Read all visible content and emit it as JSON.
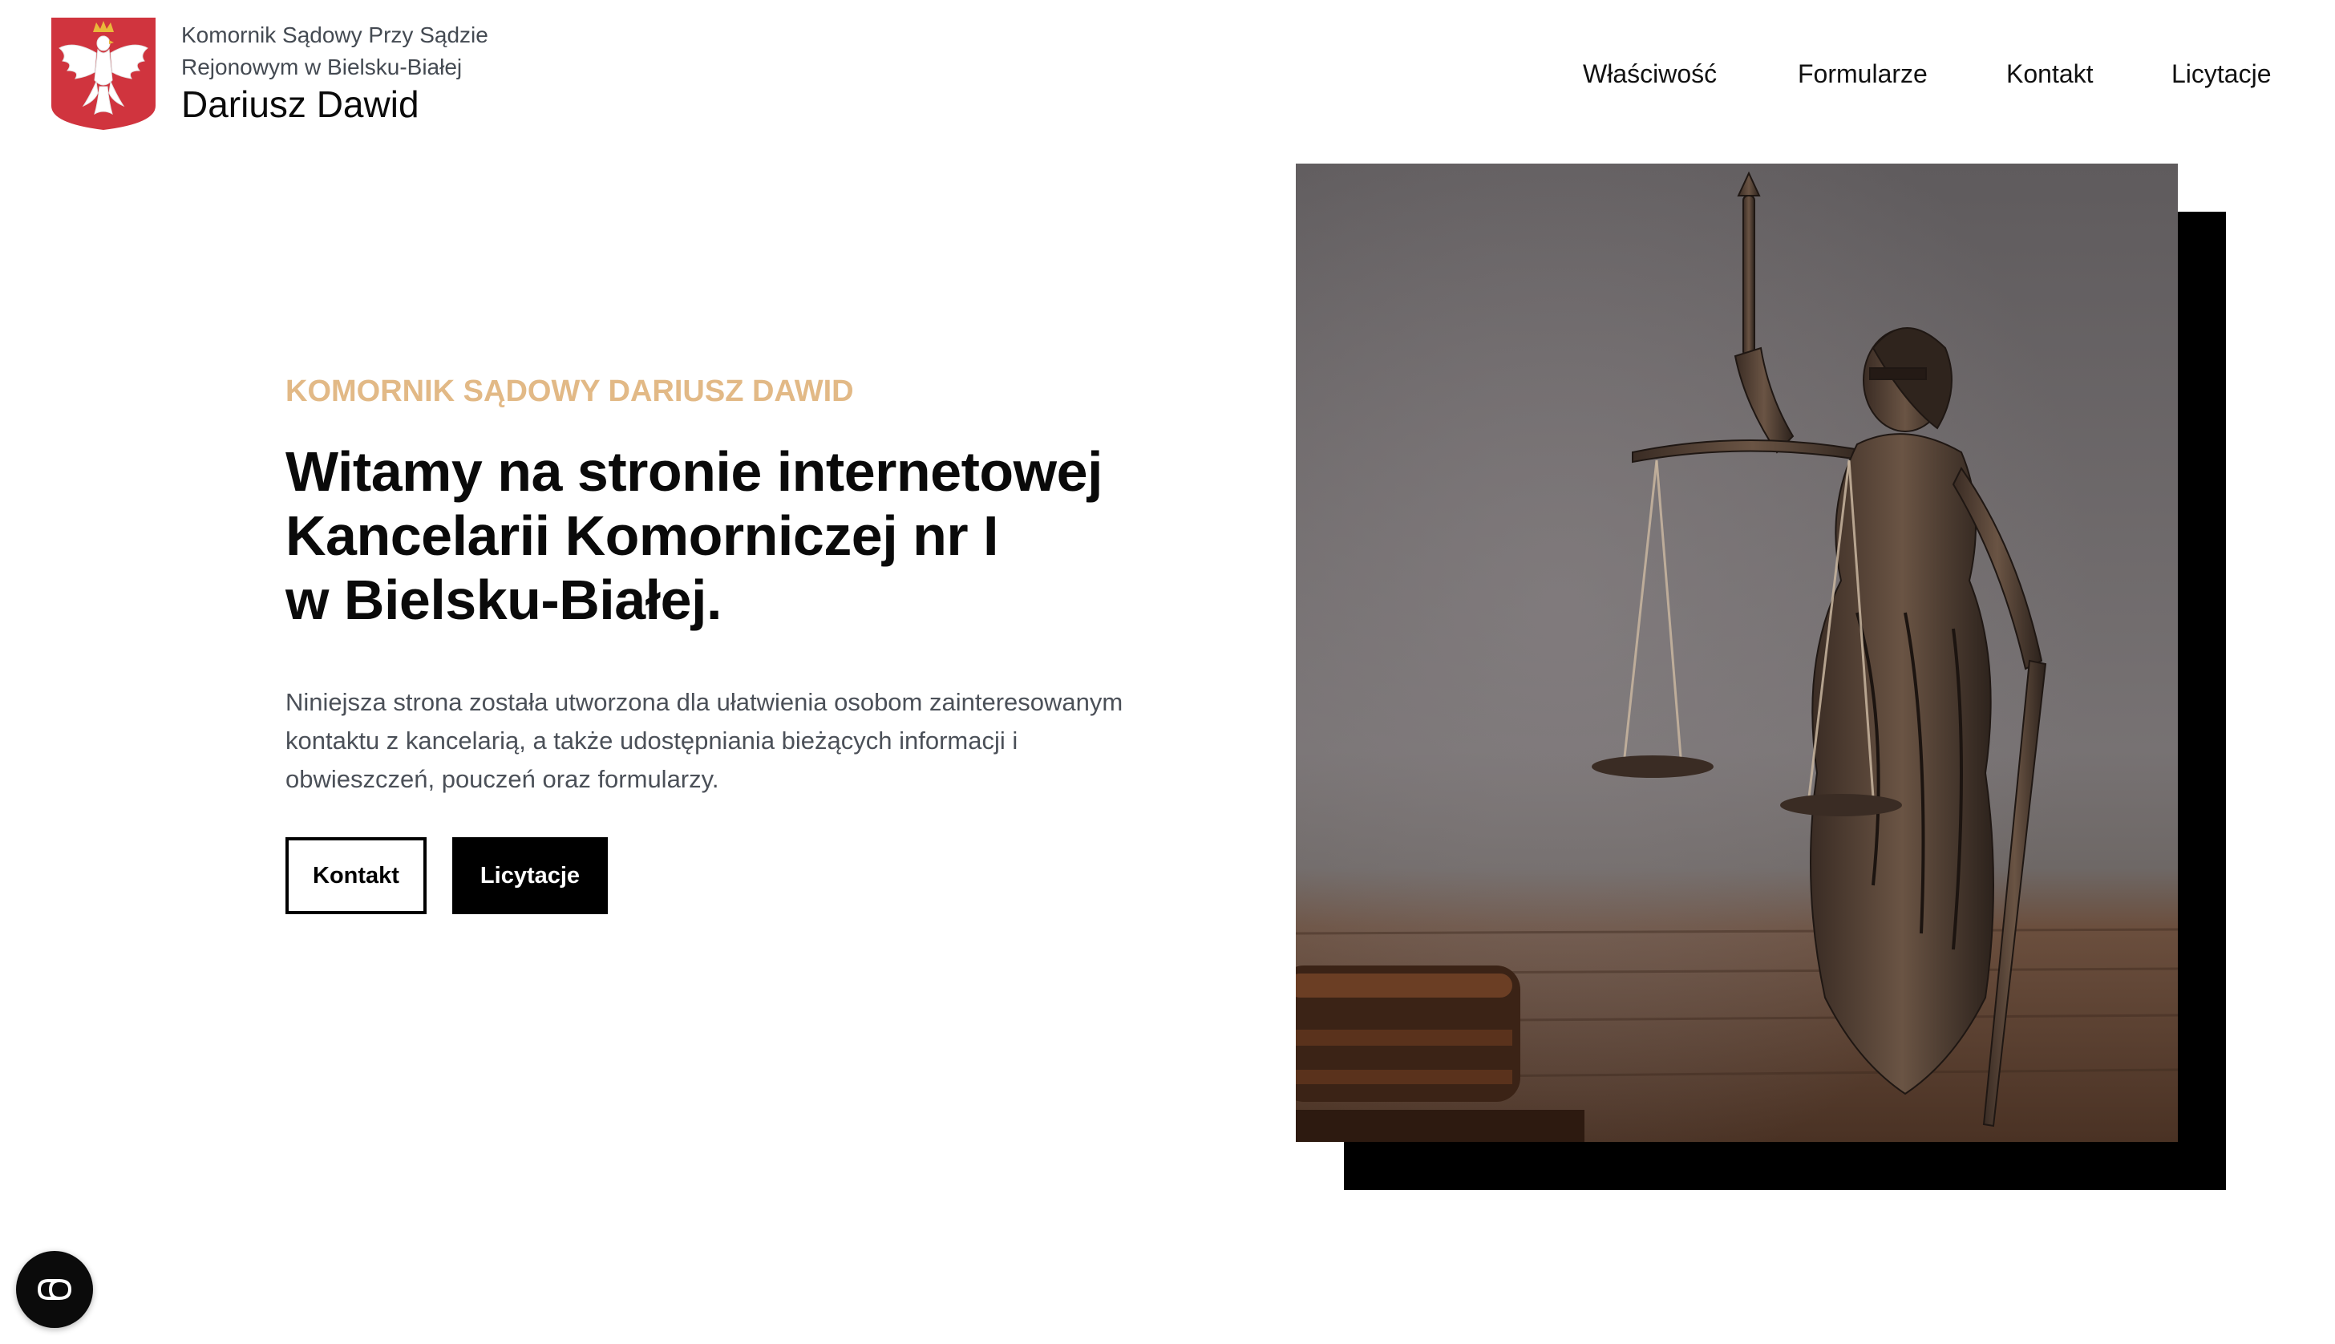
{
  "header": {
    "office_line1": "Komornik Sądowy  Przy Sądzie",
    "office_line2": "Rejonowym w Bielsku-Białej",
    "office_name": "Dariusz Dawid",
    "emblem_icon": "polish-eagle-emblem-icon",
    "emblem_color": "#d0343e"
  },
  "nav": {
    "items": [
      {
        "label": "Właściwość"
      },
      {
        "label": "Formularze"
      },
      {
        "label": "Kontakt"
      },
      {
        "label": "Licytacje"
      }
    ]
  },
  "hero": {
    "eyebrow": "KOMORNIK SĄDOWY DARIUSZ DAWID",
    "headline_lines": [
      "Witamy na stronie internetowej",
      "Kancelarii Komorniczej nr I",
      "w Bielsku-Białej."
    ],
    "description_lines": [
      "Niniejsza strona została utworzona dla ułatwienia osobom zainteresowanym",
      "kontaktu z kancelarią, a także udostępniania bieżących informacji i",
      "obwieszczeń, pouczeń oraz formularzy."
    ],
    "buttons": {
      "contact_label": "Kontakt",
      "auctions_label": "Licytacje"
    },
    "image_subject": "lady-justice-statue-with-gavel",
    "accent_color": "#e2b986"
  },
  "widgets": {
    "accessibility_icon": "accessibility-toggle-icon"
  }
}
